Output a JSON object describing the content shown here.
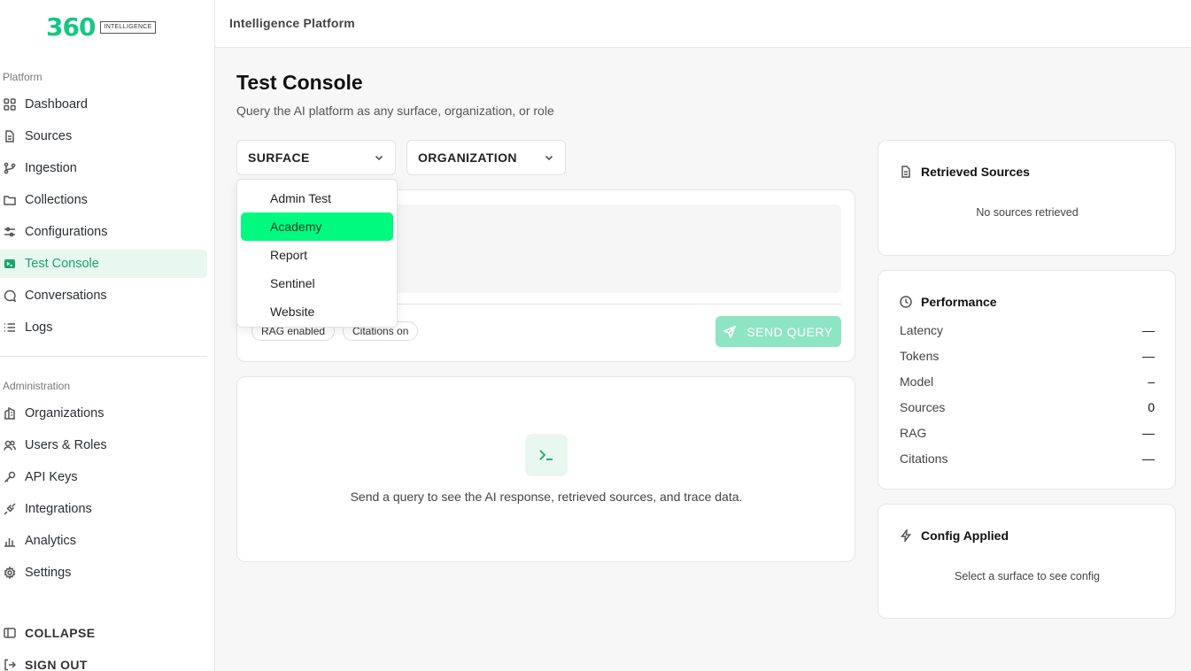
{
  "brand": {
    "number": "360",
    "badge": "INTELLIGENCE"
  },
  "sidebar": {
    "platform_label": "Platform",
    "platform_items": [
      {
        "label": "Dashboard",
        "icon": "grid-icon"
      },
      {
        "label": "Sources",
        "icon": "file-icon"
      },
      {
        "label": "Ingestion",
        "icon": "git-branch-icon"
      },
      {
        "label": "Collections",
        "icon": "folder-icon"
      },
      {
        "label": "Configurations",
        "icon": "sliders-icon"
      },
      {
        "label": "Test Console",
        "icon": "terminal-icon",
        "active": true
      },
      {
        "label": "Conversations",
        "icon": "message-icon"
      },
      {
        "label": "Logs",
        "icon": "list-icon"
      }
    ],
    "admin_label": "Administration",
    "admin_items": [
      {
        "label": "Organizations",
        "icon": "building-icon"
      },
      {
        "label": "Users & Roles",
        "icon": "users-icon"
      },
      {
        "label": "API Keys",
        "icon": "key-icon"
      },
      {
        "label": "Integrations",
        "icon": "plug-icon"
      },
      {
        "label": "Analytics",
        "icon": "bar-chart-icon"
      },
      {
        "label": "Settings",
        "icon": "gear-icon"
      }
    ],
    "collapse_label": "COLLAPSE",
    "signout_label": "SIGN OUT"
  },
  "topbar": {
    "title": "Intelligence Platform"
  },
  "main": {
    "title": "Test Console",
    "subtitle": "Query the AI platform as any surface, organization, or role",
    "surface_select": "SURFACE",
    "organization_select": "ORGANIZATION",
    "surface_options": [
      "Admin Test",
      "Academy",
      "Report",
      "Sentinel",
      "Website"
    ],
    "selected_option": "Academy",
    "chips": [
      "RAG enabled",
      "Citations on"
    ],
    "send_label": "SEND QUERY",
    "empty_text": "Send a query to see the AI response, retrieved sources, and trace data."
  },
  "panels": {
    "retrieved_sources": {
      "title": "Retrieved Sources",
      "empty": "No sources retrieved"
    },
    "performance": {
      "title": "Performance",
      "metrics": [
        {
          "label": "Latency",
          "value": "—"
        },
        {
          "label": "Tokens",
          "value": "—"
        },
        {
          "label": "Model",
          "value": "–"
        },
        {
          "label": "Sources",
          "value": "0"
        },
        {
          "label": "RAG",
          "value": "—"
        },
        {
          "label": "Citations",
          "value": "—"
        }
      ]
    },
    "config_applied": {
      "title": "Config Applied",
      "empty": "Select a surface to see config"
    }
  },
  "colors": {
    "accent": "#12a86b",
    "brand": "#16c784",
    "selected": "#00fa80",
    "send_button": "#8ee5c3"
  }
}
